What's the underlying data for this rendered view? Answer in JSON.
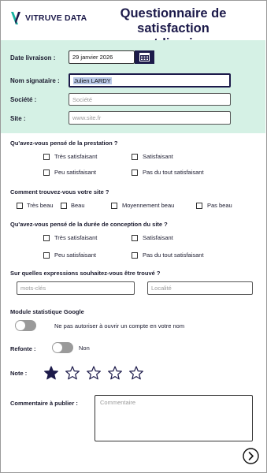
{
  "header": {
    "logo_text": "VITRUVE DATA",
    "title_line1": "Questionnaire de satisfaction",
    "title_line2": "post-livraison"
  },
  "identity": {
    "date_label": "Date livraison :",
    "date_value": "29 janvier 2026",
    "signer_label": "Nom signataire :",
    "signer_value": "Julien LARDY",
    "company_label": "Société :",
    "company_placeholder": "Société",
    "site_label": "Site :",
    "site_placeholder": "www.site.fr"
  },
  "q1": {
    "question": "Qu'avez-vous pensé de la prestation ?",
    "options": [
      "Très satisfaisant",
      "Satisfaisant",
      "Peu satisfaisant",
      "Pas du tout satisfaisant"
    ]
  },
  "q2": {
    "question": "Comment trouvez-vous votre site ?",
    "options": [
      "Très beau",
      "Beau",
      "Moyennement beau",
      "Pas beau"
    ]
  },
  "q3": {
    "question": "Qu'avez-vous pensé de la durée de conception du site ?",
    "options": [
      "Très satisfaisant",
      "Satisfaisant",
      "Peu satisfaisant",
      "Pas du tout satisfaisant"
    ]
  },
  "q4": {
    "question": "Sur quelles expressions souhaitez-vous être trouvé ?",
    "keywords_placeholder": "mots-clés",
    "locality_placeholder": "Localité"
  },
  "google": {
    "label": "Module statistique Google",
    "toggle_text": "Ne pas autoriser à ouvrir un compte en votre nom",
    "toggle_on": false
  },
  "refonte": {
    "label": "Refonte :",
    "toggle_text": "Non",
    "toggle_on": false
  },
  "rating": {
    "label": "Note :",
    "value": 1,
    "max": 5
  },
  "comment": {
    "label": "Commentaire à publier :",
    "placeholder": "Commentaire"
  },
  "colors": {
    "brand_navy": "#1c1a4a",
    "band_mint": "#d5f1e5",
    "logo_teal": "#17b2a0"
  },
  "icons": {
    "calendar": "calendar-icon",
    "next": "chevron-right-circle-icon",
    "star_filled": "star-filled-icon",
    "star_empty": "star-outline-icon"
  }
}
